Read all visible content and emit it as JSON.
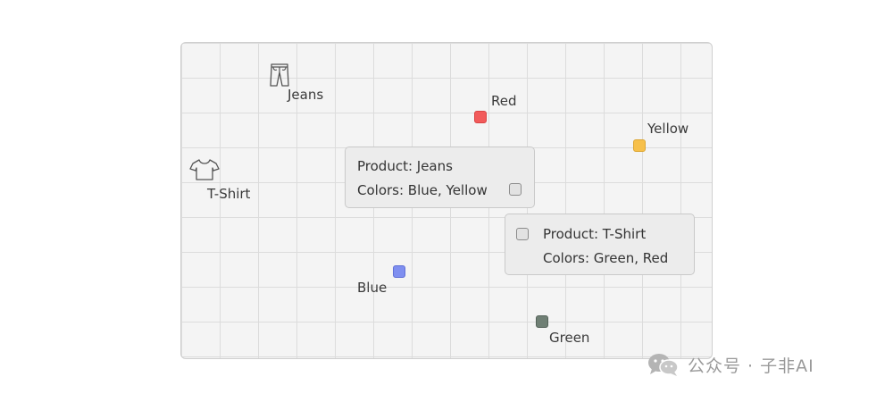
{
  "items": {
    "jeans": {
      "label": "Jeans",
      "icon": "jeans-icon"
    },
    "tshirt": {
      "label": "T-Shirt",
      "icon": "tshirt-icon"
    }
  },
  "colors": {
    "red": {
      "label": "Red",
      "hex": "#f25a5a"
    },
    "yellow": {
      "label": "Yellow",
      "hex": "#f7c04a"
    },
    "blue": {
      "label": "Blue",
      "hex": "#7f8ff0"
    },
    "green": {
      "label": "Green",
      "hex": "#6f7f74"
    }
  },
  "tooltips": {
    "jeans": {
      "product": "Product: Jeans",
      "colors": "Colors: Blue, Yellow"
    },
    "tshirt": {
      "product": "Product: T-Shirt",
      "colors": "Colors: Green, Red"
    }
  },
  "watermark": {
    "text": "公众号 · 子非AI",
    "icon": "wechat-icon"
  }
}
